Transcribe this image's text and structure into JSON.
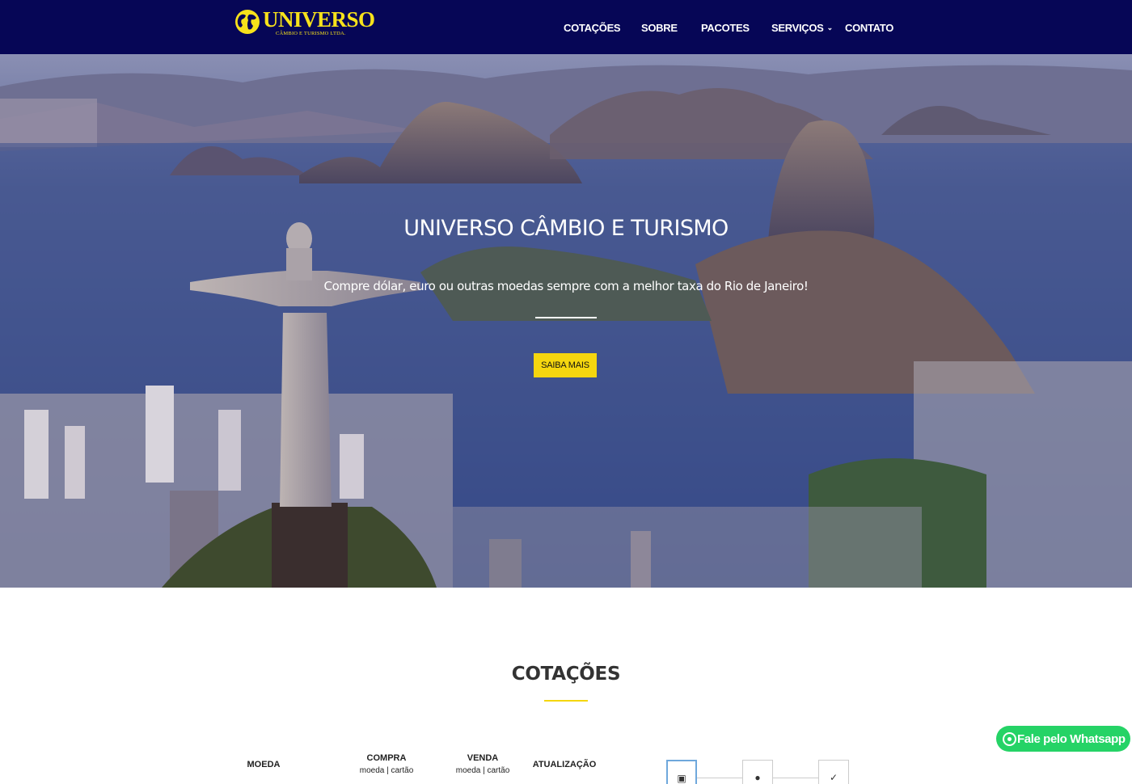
{
  "brand": {
    "name": "UNIVERSO",
    "tagline": "CÂMBIO E TURISMO LTDA.",
    "color_primary": "#060656",
    "color_accent": "#f5d60f",
    "logo_icon": "globe-icon"
  },
  "nav": {
    "items": [
      {
        "label": "COTAÇÕES"
      },
      {
        "label": "SOBRE"
      },
      {
        "label": "PACOTES"
      },
      {
        "label": "SERVIÇOS",
        "has_dropdown": true
      },
      {
        "label": "CONTATO"
      }
    ]
  },
  "hero": {
    "title": "UNIVERSO CÂMBIO E TURISMO",
    "subtitle": "Compre dólar, euro ou outras moedas sempre com a melhor taxa do Rio de Janeiro!",
    "button_label": "SAIBA MAIS",
    "image_description_icon": "rio-de-janeiro-photo"
  },
  "quotes": {
    "title": "COTAÇÕES",
    "columns": {
      "currency": "MOEDA",
      "buy": "COMPRA",
      "buy_sub": "moeda | cartão",
      "sell": "VENDA",
      "sell_sub": "moeda | cartão",
      "updated": "ATUALIZAÇÃO"
    },
    "tabs": [
      {
        "icon": "card-icon",
        "active": true
      },
      {
        "icon": "person-icon",
        "active": false
      },
      {
        "icon": "check-icon",
        "active": false
      }
    ]
  },
  "whatsapp": {
    "label": "Fale pelo Whatsapp",
    "color": "#25d366",
    "icon": "whatsapp-icon"
  }
}
